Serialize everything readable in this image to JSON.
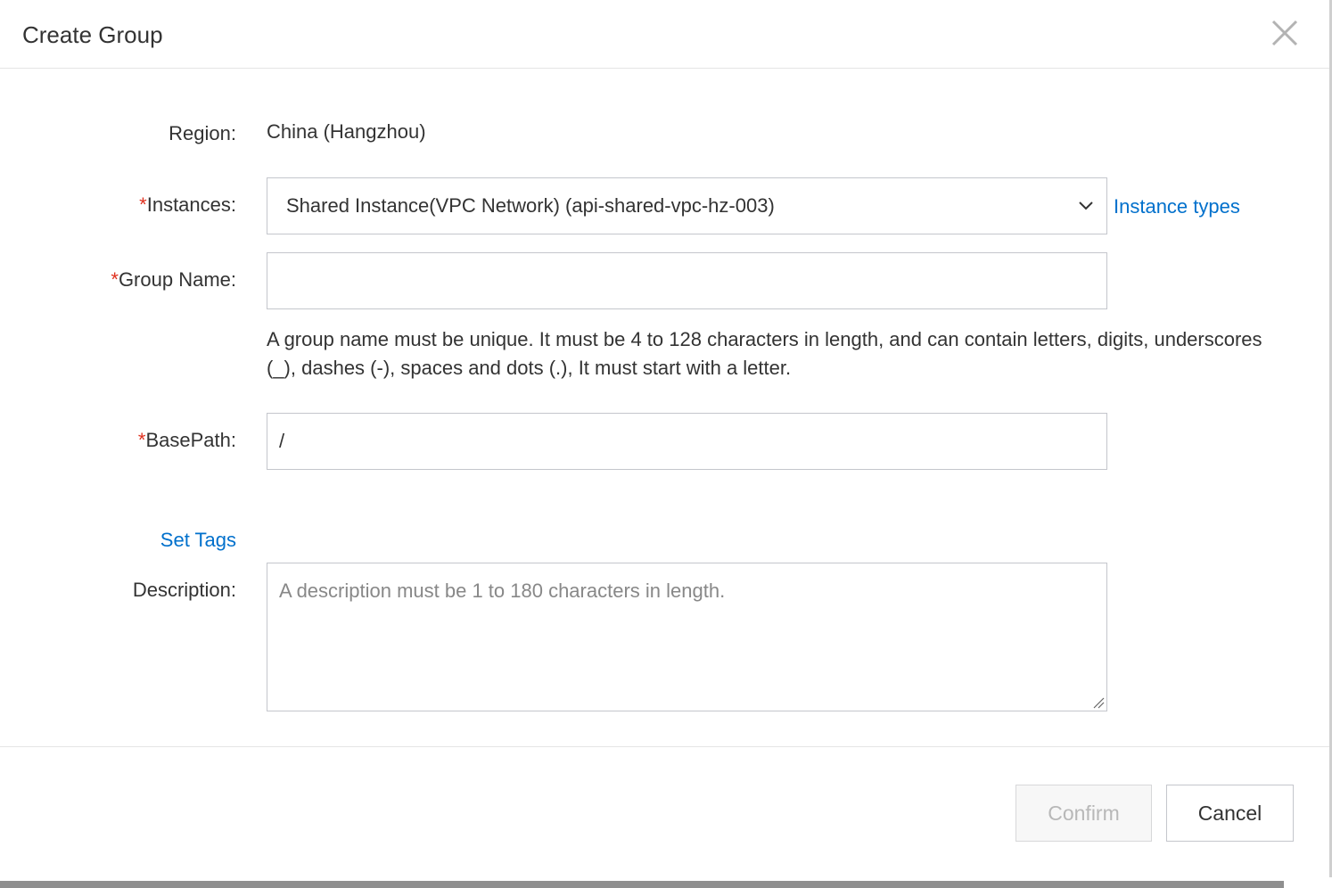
{
  "dialog": {
    "title": "Create Group"
  },
  "form": {
    "region": {
      "label": "Region:",
      "value": "China (Hangzhou)"
    },
    "instances": {
      "required_mark": "*",
      "label": "Instances:",
      "selected": "Shared Instance(VPC Network) (api-shared-vpc-hz-003)",
      "link": "Instance types"
    },
    "group_name": {
      "required_mark": "*",
      "label": "Group Name:",
      "value": "",
      "help": "A group name must be unique. It must be 4 to 128 characters in length, and can contain letters, digits, underscores (_), dashes (-), spaces and dots (.), It must start with a letter."
    },
    "base_path": {
      "required_mark": "*",
      "label": "BasePath:",
      "value": "/"
    },
    "set_tags_link": "Set Tags",
    "description": {
      "label": "Description:",
      "placeholder": "A description must be 1 to 180 characters in length."
    }
  },
  "footer": {
    "confirm_label": "Confirm",
    "cancel_label": "Cancel"
  },
  "colors": {
    "link": "#0070cc",
    "required": "#e0301e",
    "border": "#c4c6cc",
    "disabled_text": "#b8b8b8"
  },
  "icons": {
    "close": "close-icon",
    "dropdown": "chevron-down-icon",
    "resize": "resize-handle-icon"
  }
}
